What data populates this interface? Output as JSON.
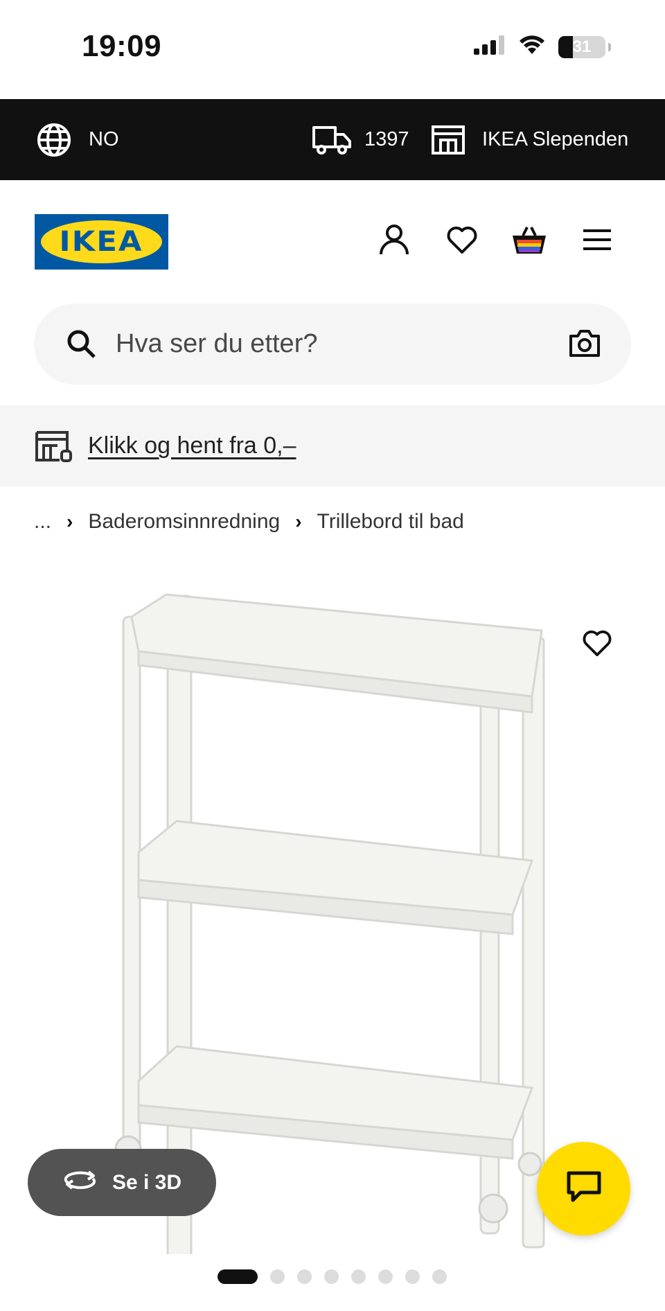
{
  "status_bar": {
    "time": "19:09",
    "battery": 31,
    "icons": [
      "signal-icon",
      "wifi-icon",
      "battery-icon"
    ]
  },
  "top_bar": {
    "language": "NO",
    "postal_code": "1397",
    "store": "IKEA Slependen",
    "icons": [
      "globe-icon",
      "delivery-truck-icon",
      "store-icon"
    ]
  },
  "header": {
    "logo_text": "IKEA",
    "icons": [
      "user-icon",
      "heart-icon",
      "shopping-basket-icon",
      "menu-icon"
    ],
    "colors": {
      "logo_blue": "#0058a3",
      "logo_yellow": "#ffda1a"
    }
  },
  "search": {
    "placeholder": "Hva ser du etter?",
    "icons": [
      "search-icon",
      "camera-icon"
    ]
  },
  "promo": {
    "text": "Klikk og hent fra 0,–",
    "icon": "click-collect-icon"
  },
  "breadcrumb": {
    "items": [
      "...",
      "Baderomsinnredning",
      "Trillebord til bad"
    ]
  },
  "gallery": {
    "view_3d_label": "Se i 3D",
    "image_count": 8,
    "active_index": 0,
    "chat_color": "#ffdb00"
  }
}
